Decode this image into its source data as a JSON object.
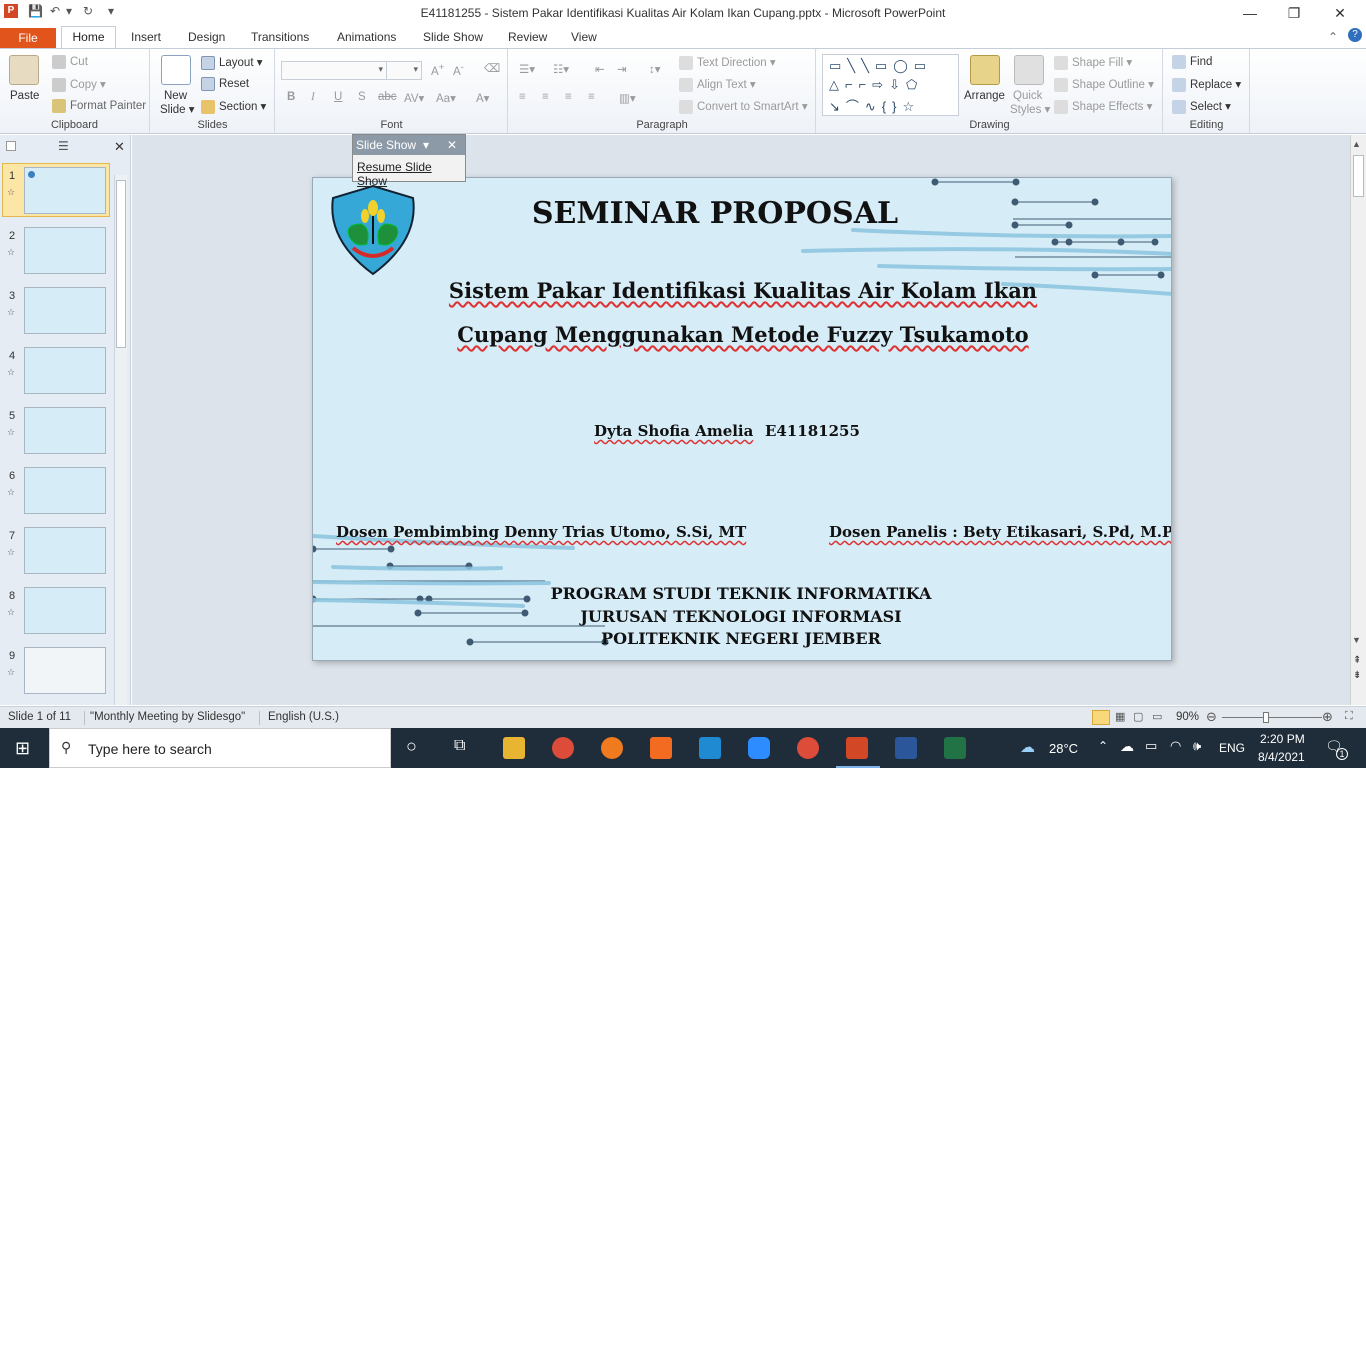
{
  "window": {
    "title": "E41181255 - Sistem Pakar Identifikasi Kualitas Air Kolam Ikan Cupang.pptx  -  Microsoft PowerPoint",
    "minimize": "—",
    "restore": "❐",
    "close": "✕"
  },
  "tabs": [
    "File",
    "Home",
    "Insert",
    "Design",
    "Transitions",
    "Animations",
    "Slide Show",
    "Review",
    "View"
  ],
  "ribbon": {
    "clipboard": {
      "label": "Clipboard",
      "paste": "Paste",
      "cut": "Cut",
      "copy": "Copy",
      "format_painter": "Format Painter"
    },
    "slides": {
      "label": "Slides",
      "new_slide": "New",
      "new_slide2": "Slide",
      "layout": "Layout",
      "reset": "Reset",
      "section": "Section"
    },
    "font": {
      "label": "Font"
    },
    "paragraph": {
      "label": "Paragraph",
      "text_direction": "Text Direction",
      "align_text": "Align Text",
      "convert_smartart": "Convert to SmartArt"
    },
    "drawing": {
      "label": "Drawing",
      "arrange": "Arrange",
      "quick_styles": "Quick",
      "quick_styles2": "Styles",
      "shape_fill": "Shape Fill",
      "shape_outline": "Shape Outline",
      "shape_effects": "Shape Effects"
    },
    "editing": {
      "label": "Editing",
      "find": "Find",
      "replace": "Replace",
      "select": "Select"
    }
  },
  "slideshow_toolbar": {
    "title": "Slide Show",
    "resume": "Resume Slide Show"
  },
  "thumbnails": [
    "1",
    "2",
    "3",
    "4",
    "5",
    "6",
    "7",
    "8",
    "9"
  ],
  "slide": {
    "title": "SEMINAR PROPOSAL",
    "subtitle_line1": "Sistem Pakar Identifikasi Kualitas Air Kolam Ikan",
    "subtitle_line2": "Cupang Menggunakan  Metode Fuzzy  Tsukamoto",
    "author": "Dyta Shofia Amelia",
    "nim": "E41181255",
    "pembimbing": "Dosen Pembimbing  Denny Trias Utomo, S.Si, MT",
    "panelis": "Dosen Panelis : Bety Etikasari, S.Pd, M.Pd",
    "prodi": "PROGRAM STUDI TEKNIK INFORMATIKA",
    "jurusan": "JURUSAN TEKNOLOGI INFORMASI",
    "poltek": "POLITEKNIK NEGERI JEMBER"
  },
  "status": {
    "slide_pos": "Slide 1 of 11",
    "theme": "\"Monthly Meeting by Slidesgo\"",
    "language": "English (U.S.)",
    "zoom": "90%"
  },
  "taskbar": {
    "search_placeholder": "Type here to search",
    "temperature": "28°C",
    "lang": "ENG",
    "time": "2:20 PM",
    "date": "8/4/2021",
    "notif_count": "1"
  },
  "colors": {
    "file_tab": "#e1541c",
    "slide_bg": "#d6ecf7",
    "taskbar": "#1f2d3a",
    "accent_line": "#3f5a73"
  }
}
